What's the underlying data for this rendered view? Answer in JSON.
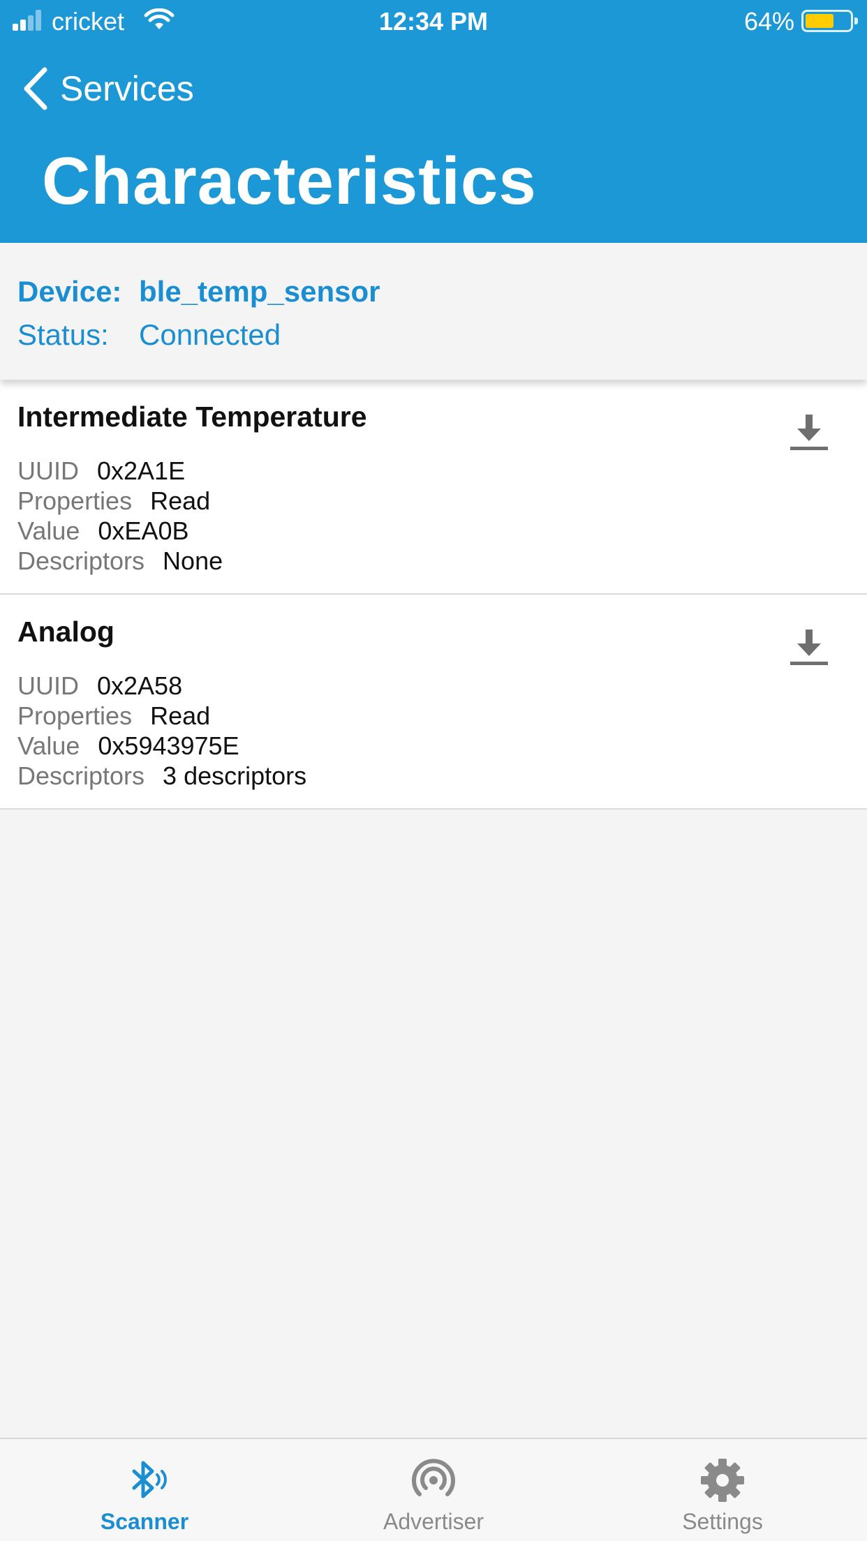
{
  "status_bar": {
    "carrier": "cricket",
    "time": "12:34 PM",
    "battery_percent": "64%",
    "battery_level": 0.64,
    "battery_color": "#ffcc00"
  },
  "nav": {
    "back_label": "Services",
    "title": "Characteristics"
  },
  "device": {
    "device_label": "Device:",
    "device_name": "ble_temp_sensor",
    "status_label": "Status:",
    "status_value": "Connected"
  },
  "characteristics": [
    {
      "name": "Intermediate Temperature",
      "uuid_label": "UUID",
      "uuid": "0x2A1E",
      "properties_label": "Properties",
      "properties": "Read",
      "value_label": "Value",
      "value": "0xEA0B",
      "descriptors_label": "Descriptors",
      "descriptors": "None",
      "action_icon": "download-icon"
    },
    {
      "name": "Analog",
      "uuid_label": "UUID",
      "uuid": "0x2A58",
      "properties_label": "Properties",
      "properties": "Read",
      "value_label": "Value",
      "value": "0x5943975E",
      "descriptors_label": "Descriptors",
      "descriptors": "3 descriptors",
      "action_icon": "download-icon"
    }
  ],
  "tabbar": {
    "tabs": [
      {
        "label": "Scanner",
        "icon": "bluetooth-icon",
        "active": true
      },
      {
        "label": "Advertiser",
        "icon": "broadcast-icon",
        "active": false
      },
      {
        "label": "Settings",
        "icon": "gear-icon",
        "active": false
      }
    ]
  },
  "colors": {
    "header_blue": "#1b98d5",
    "accent_blue": "#1b8ed1",
    "background": "#f4f4f4"
  }
}
